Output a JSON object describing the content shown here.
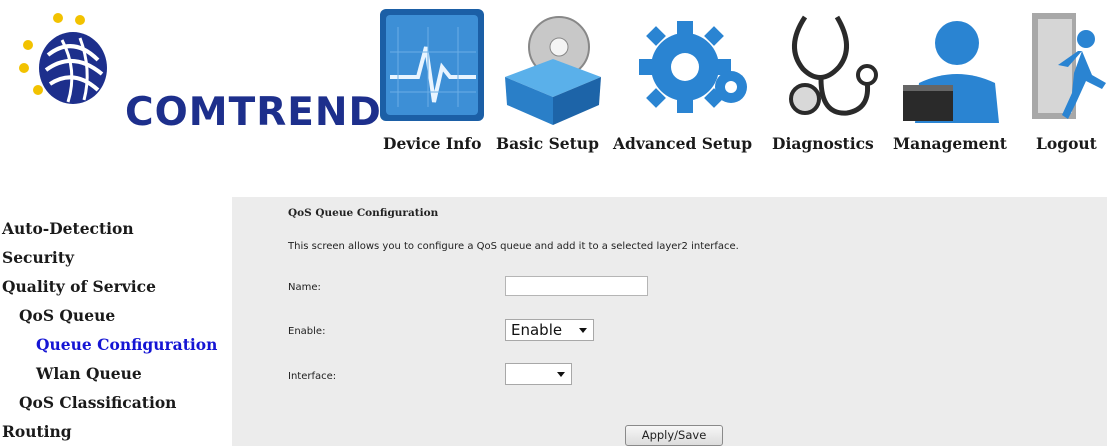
{
  "brand": {
    "logo_text": "COMTREND"
  },
  "nav": [
    {
      "label": "Device Info",
      "icon": "device-info-icon"
    },
    {
      "label": "Basic Setup",
      "icon": "basic-setup-icon"
    },
    {
      "label": "Advanced Setup",
      "icon": "advanced-setup-icon"
    },
    {
      "label": "Diagnostics",
      "icon": "diagnostics-icon"
    },
    {
      "label": "Management",
      "icon": "management-icon"
    },
    {
      "label": "Logout",
      "icon": "logout-icon"
    }
  ],
  "sidebar": {
    "items": [
      {
        "label": "Auto-Detection"
      },
      {
        "label": "Security"
      },
      {
        "label": "Quality of Service"
      },
      {
        "label": "QoS Queue"
      },
      {
        "label": "Queue Configuration"
      },
      {
        "label": "Wlan Queue"
      },
      {
        "label": "QoS Classification"
      },
      {
        "label": "Routing"
      }
    ],
    "active_color": "#1515d4"
  },
  "form": {
    "title": "QoS Queue Configuration",
    "description": "This screen allows you to configure a QoS queue and add it to a selected layer2 interface.",
    "name_label": "Name:",
    "name_value": "",
    "enable_label": "Enable:",
    "enable_value": "Enable",
    "interface_label": "Interface:",
    "interface_value": "",
    "apply_label": "Apply/Save"
  },
  "colors": {
    "panel_bg": "#ececec",
    "brand_blue": "#1d2f8c"
  }
}
